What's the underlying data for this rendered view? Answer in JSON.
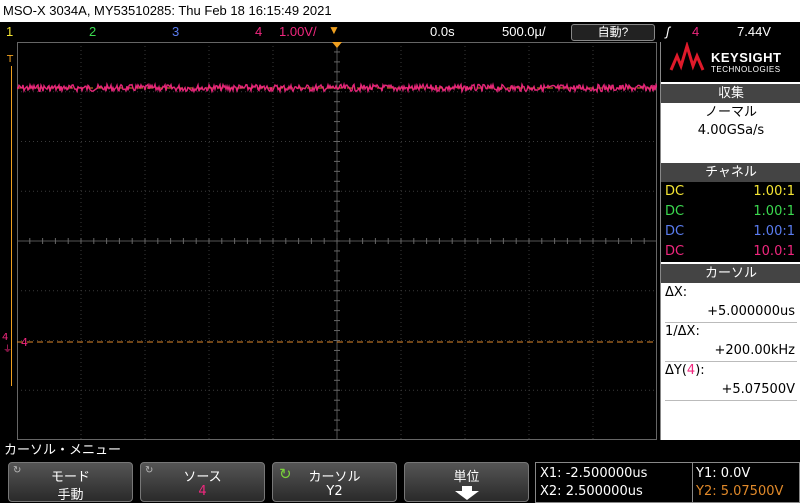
{
  "title_bar": {
    "text": "MSO-X 3034A, MY53510285: Thu Feb 18 16:15:49 2021"
  },
  "status_bar": {
    "ch1": "1",
    "ch2": "2",
    "ch3": "3",
    "ch4": "4",
    "scale": "1.00V/",
    "delay": "0.0s",
    "timebase": "500.0µ/",
    "mode": "自動?",
    "trigger_icon": "ʃ",
    "trigger_source": "4",
    "trigger_level": "7.44V"
  },
  "colors": {
    "ch1": "#f5e633",
    "ch2": "#3bd94f",
    "ch3": "#5a7cf0",
    "ch4": "#f0277e",
    "cursor": "#e0892a",
    "trigger_marker": "#f0a020"
  },
  "logo": {
    "line1": "KEYSIGHT",
    "line2": "TECHNOLOGIES"
  },
  "acquisition": {
    "header": "収集",
    "mode": "ノーマル",
    "rate": "4.00GSa/s"
  },
  "channels": {
    "header": "チャネル",
    "rows": [
      {
        "coupling": "DC",
        "probe": "1.00:1"
      },
      {
        "coupling": "DC",
        "probe": "1.00:1"
      },
      {
        "coupling": "DC",
        "probe": "1.00:1"
      },
      {
        "coupling": "DC",
        "probe": "10.0:1"
      }
    ]
  },
  "cursors": {
    "header": "カーソル",
    "dx_label": "ΔX:",
    "dx_value": "+5.000000us",
    "inv_label": "1/ΔX:",
    "inv_value": "+200.00kHz",
    "dy_label": "ΔY(",
    "dy_ch": "4",
    "dy_close": "):",
    "dy_value": "+5.07500V"
  },
  "grid_markers": {
    "trigger_label": "T",
    "ch4_label": "4",
    "ch4_ref_label": "4"
  },
  "menu": {
    "title": "カーソル・メニュー",
    "softkeys": [
      {
        "top": "モード",
        "bottom": "手動"
      },
      {
        "top": "ソース",
        "bottom": "4"
      },
      {
        "top": "カーソル",
        "bottom": "Y2"
      },
      {
        "top": "単位",
        "bottom": ""
      }
    ]
  },
  "readout": {
    "x1": "X1: -2.500000us",
    "x2": "X2: 2.500000us",
    "y1": "Y1: 0.0V",
    "y2": "Y2: 5.07500V"
  }
}
